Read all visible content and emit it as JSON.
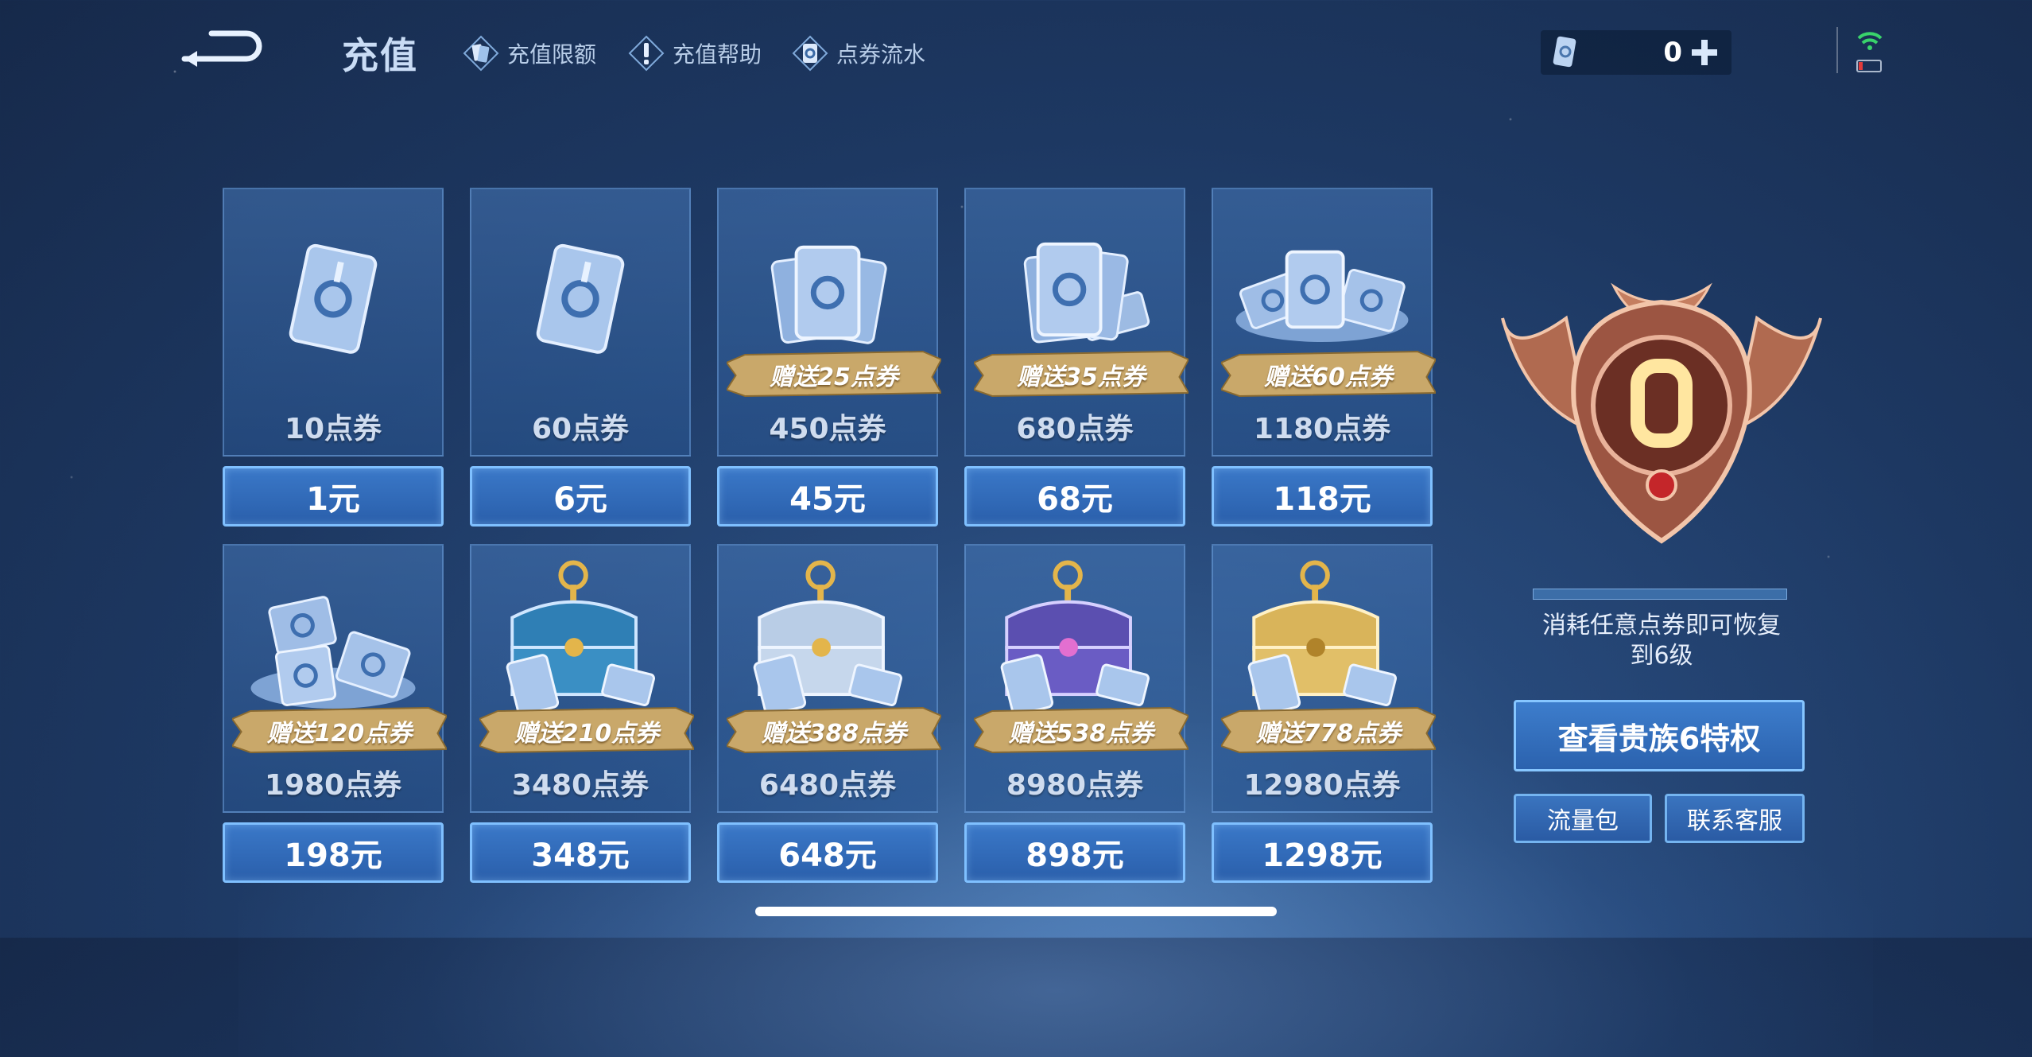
{
  "header": {
    "title": "充值",
    "links": [
      {
        "label": "充值限额",
        "icon": "cards-icon"
      },
      {
        "label": "充值帮助",
        "icon": "help-icon"
      },
      {
        "label": "点券流水",
        "icon": "coupon-flow-icon"
      }
    ],
    "coupon_balance": "0"
  },
  "packages": [
    {
      "amount": "10点券",
      "price": "1元",
      "bonus": "",
      "art": "single-coupon"
    },
    {
      "amount": "60点券",
      "price": "6元",
      "bonus": "",
      "art": "single-coupon"
    },
    {
      "amount": "450点券",
      "price": "45元",
      "bonus": "赠送25点券",
      "art": "coupon-fan"
    },
    {
      "amount": "680点券",
      "price": "68元",
      "bonus": "赠送35点券",
      "art": "coupon-fan"
    },
    {
      "amount": "1180点券",
      "price": "118元",
      "bonus": "赠送60点券",
      "art": "coupon-pile"
    },
    {
      "amount": "1980点券",
      "price": "198元",
      "bonus": "赠送120点券",
      "art": "coupon-pile"
    },
    {
      "amount": "3480点券",
      "price": "348元",
      "bonus": "赠送210点券",
      "art": "chest-blue"
    },
    {
      "amount": "6480点券",
      "price": "648元",
      "bonus": "赠送388点券",
      "art": "chest-silver"
    },
    {
      "amount": "8980点券",
      "price": "898元",
      "bonus": "赠送538点券",
      "art": "chest-purple"
    },
    {
      "amount": "12980点券",
      "price": "1298元",
      "bonus": "赠送778点券",
      "art": "chest-gold"
    }
  ],
  "vip": {
    "level": "0",
    "desc_line1": "消耗任意点券即可恢复",
    "desc_line2": "到6级",
    "privilege_button": "查看贵族6特权"
  },
  "footer_buttons": {
    "data_pack": "流量包",
    "contact": "联系客服"
  },
  "colors": {
    "accent_blue": "#7fc0ff",
    "ribbon_gold": "#c9a86a",
    "emblem_bronze": "#b06a50",
    "level_digit": "#ffe6a0"
  }
}
